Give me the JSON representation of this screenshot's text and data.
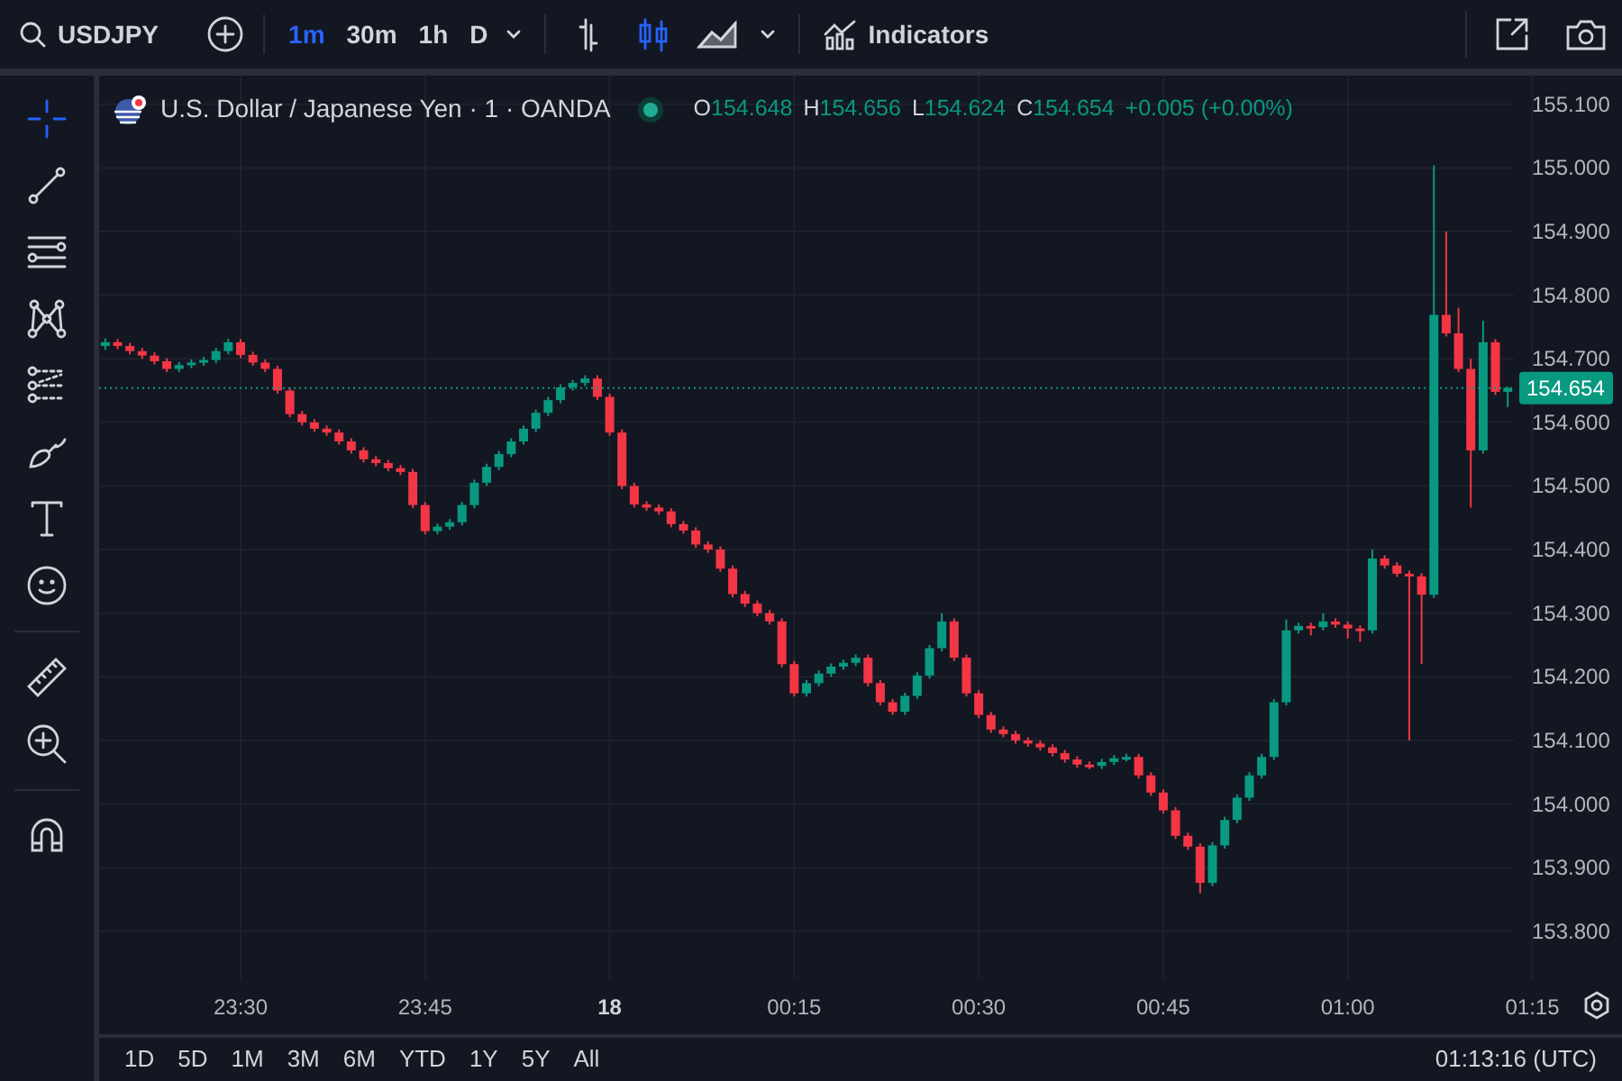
{
  "toolbar": {
    "symbol": "USDJPY",
    "timeframes": [
      {
        "label": "1m",
        "selected": true
      },
      {
        "label": "30m",
        "selected": false
      },
      {
        "label": "1h",
        "selected": false
      },
      {
        "label": "D",
        "selected": false
      }
    ],
    "chart_types": [
      {
        "kind": "bars",
        "selected": false
      },
      {
        "kind": "candles",
        "selected": true
      },
      {
        "kind": "area",
        "selected": false
      }
    ],
    "indicators_label": "Indicators"
  },
  "legend": {
    "title": "U.S. Dollar / Japanese Yen · 1 · OANDA",
    "ohlc": [
      {
        "label": "O",
        "value": "154.648"
      },
      {
        "label": "H",
        "value": "154.656"
      },
      {
        "label": "L",
        "value": "154.624"
      },
      {
        "label": "C",
        "value": "154.654"
      }
    ],
    "change": "+0.005 (+0.00%)"
  },
  "chart": {
    "chart_data": {
      "type": "candlestick",
      "grid": true,
      "ylim": [
        153.726,
        155.145
      ],
      "ref_lines": [
        {
          "axis": "y",
          "value": 154.654,
          "label": "154.654"
        }
      ],
      "yticks": [
        {
          "value": 155.1,
          "label": "155.100"
        },
        {
          "value": 155.0,
          "label": "155.000"
        },
        {
          "value": 154.9,
          "label": "154.900"
        },
        {
          "value": 154.8,
          "label": "154.800"
        },
        {
          "value": 154.7,
          "label": "154.700"
        },
        {
          "value": 154.6,
          "label": "154.600"
        },
        {
          "value": 154.5,
          "label": "154.500"
        },
        {
          "value": 154.4,
          "label": "154.400"
        },
        {
          "value": 154.3,
          "label": "154.300"
        },
        {
          "value": 154.2,
          "label": "154.200"
        },
        {
          "value": 154.1,
          "label": "154.100"
        },
        {
          "value": 154.0,
          "label": "154.000"
        },
        {
          "value": 153.9,
          "label": "153.900"
        },
        {
          "value": 153.8,
          "label": "153.800"
        }
      ],
      "categories": [
        null,
        null,
        null,
        null,
        null,
        null,
        null,
        null,
        null,
        null,
        null,
        null,
        null,
        null,
        null,
        null,
        null,
        null,
        null,
        null,
        null,
        null,
        null,
        null,
        null,
        null,
        null,
        null,
        null,
        null,
        null,
        null,
        null,
        null,
        null,
        null,
        null,
        null,
        null,
        null,
        null,
        null,
        null,
        null,
        null,
        null,
        null,
        null,
        null,
        null,
        null,
        null,
        null,
        null,
        null,
        null,
        null,
        null,
        null,
        null,
        null,
        null,
        null,
        null,
        null,
        null,
        null,
        null,
        null,
        null,
        null,
        null,
        null,
        null,
        null,
        null,
        null,
        null,
        null,
        null,
        null,
        null,
        null,
        null,
        null,
        null,
        null,
        null,
        null,
        null,
        null,
        null,
        null,
        null,
        null,
        null,
        null,
        null,
        null,
        null,
        null,
        null,
        null,
        null,
        null,
        null,
        null,
        null,
        null,
        null,
        null,
        null,
        null,
        null,
        null
      ],
      "ohlc": [
        [
          154.72,
          154.732,
          154.714,
          154.726
        ],
        [
          154.726,
          154.731,
          154.715,
          154.72
        ],
        [
          154.72,
          154.725,
          154.707,
          154.712
        ],
        [
          154.712,
          154.717,
          154.7,
          154.705
        ],
        [
          154.705,
          154.71,
          154.691,
          154.696
        ],
        [
          154.696,
          154.701,
          154.679,
          154.684
        ],
        [
          154.684,
          154.695,
          154.679,
          154.69
        ],
        [
          154.69,
          154.699,
          154.685,
          154.694
        ],
        [
          154.694,
          154.703,
          154.689,
          154.698
        ],
        [
          154.698,
          154.717,
          154.693,
          154.712
        ],
        [
          154.712,
          154.731,
          154.707,
          154.726
        ],
        [
          154.726,
          154.731,
          154.701,
          154.706
        ],
        [
          154.706,
          154.711,
          154.689,
          154.694
        ],
        [
          154.694,
          154.699,
          154.679,
          154.684
        ],
        [
          154.684,
          154.689,
          154.645,
          154.65
        ],
        [
          154.65,
          154.655,
          154.608,
          154.613
        ],
        [
          154.613,
          154.618,
          154.595,
          154.6
        ],
        [
          154.6,
          154.605,
          154.585,
          154.59
        ],
        [
          154.59,
          154.595,
          154.579,
          154.584
        ],
        [
          154.584,
          154.589,
          154.565,
          154.57
        ],
        [
          154.57,
          154.575,
          154.551,
          154.556
        ],
        [
          154.556,
          154.561,
          154.537,
          154.542
        ],
        [
          154.542,
          154.547,
          154.531,
          154.536
        ],
        [
          154.536,
          154.541,
          154.523,
          154.528
        ],
        [
          154.528,
          154.533,
          154.517,
          154.522
        ],
        [
          154.522,
          154.527,
          154.465,
          154.47
        ],
        [
          154.47,
          154.475,
          154.424,
          154.429
        ],
        [
          154.429,
          154.441,
          154.424,
          154.436
        ],
        [
          154.436,
          154.448,
          154.431,
          154.443
        ],
        [
          154.443,
          154.475,
          154.438,
          154.47
        ],
        [
          154.47,
          154.51,
          154.465,
          154.505
        ],
        [
          154.505,
          154.535,
          154.5,
          154.53
        ],
        [
          154.53,
          154.555,
          154.525,
          154.55
        ],
        [
          154.55,
          154.575,
          154.545,
          154.57
        ],
        [
          154.57,
          154.595,
          154.565,
          154.59
        ],
        [
          154.59,
          154.62,
          154.585,
          154.615
        ],
        [
          154.615,
          154.64,
          154.61,
          154.635
        ],
        [
          154.635,
          154.66,
          154.63,
          154.655
        ],
        [
          154.655,
          154.667,
          154.65,
          154.662
        ],
        [
          154.662,
          154.674,
          154.657,
          154.669
        ],
        [
          154.669,
          154.674,
          154.635,
          154.64
        ],
        [
          154.64,
          154.645,
          154.579,
          154.584
        ],
        [
          154.584,
          154.589,
          154.495,
          154.5
        ],
        [
          154.5,
          154.505,
          154.466,
          154.471
        ],
        [
          154.471,
          154.476,
          154.461,
          154.466
        ],
        [
          154.466,
          154.471,
          154.455,
          154.46
        ],
        [
          154.46,
          154.465,
          154.435,
          154.44
        ],
        [
          154.44,
          154.445,
          154.425,
          154.43
        ],
        [
          154.43,
          154.435,
          154.403,
          154.408
        ],
        [
          154.408,
          154.413,
          154.395,
          154.4
        ],
        [
          154.4,
          154.405,
          154.365,
          154.37
        ],
        [
          154.37,
          154.375,
          154.325,
          154.33
        ],
        [
          154.33,
          154.335,
          154.31,
          154.315
        ],
        [
          154.315,
          154.32,
          154.295,
          154.3
        ],
        [
          154.3,
          154.305,
          154.282,
          154.287
        ],
        [
          154.287,
          154.292,
          154.215,
          154.22
        ],
        [
          154.22,
          154.225,
          154.169,
          154.174
        ],
        [
          154.174,
          154.195,
          154.169,
          154.19
        ],
        [
          154.19,
          154.21,
          154.185,
          154.205
        ],
        [
          154.205,
          154.221,
          154.2,
          154.216
        ],
        [
          154.216,
          154.227,
          154.211,
          154.222
        ],
        [
          154.222,
          154.235,
          154.217,
          154.23
        ],
        [
          154.23,
          154.235,
          154.185,
          154.19
        ],
        [
          154.19,
          154.195,
          154.155,
          154.16
        ],
        [
          154.16,
          154.165,
          154.14,
          154.145
        ],
        [
          154.145,
          154.175,
          154.14,
          154.17
        ],
        [
          154.17,
          154.207,
          154.165,
          154.202
        ],
        [
          154.202,
          154.25,
          154.197,
          154.245
        ],
        [
          154.245,
          154.3,
          154.24,
          154.287
        ],
        [
          154.287,
          154.292,
          154.225,
          154.23
        ],
        [
          154.23,
          154.235,
          154.169,
          154.174
        ],
        [
          154.174,
          154.179,
          154.135,
          154.14
        ],
        [
          154.14,
          154.145,
          154.112,
          154.117
        ],
        [
          154.117,
          154.122,
          154.105,
          154.11
        ],
        [
          154.11,
          154.115,
          154.095,
          154.1
        ],
        [
          154.1,
          154.105,
          154.09,
          154.095
        ],
        [
          154.095,
          154.1,
          154.084,
          154.089
        ],
        [
          154.089,
          154.094,
          154.075,
          154.08
        ],
        [
          154.08,
          154.085,
          154.065,
          154.07
        ],
        [
          154.07,
          154.075,
          154.057,
          154.062
        ],
        [
          154.062,
          154.067,
          154.055,
          154.06
        ],
        [
          154.06,
          154.071,
          154.055,
          154.066
        ],
        [
          154.066,
          154.077,
          154.061,
          154.072
        ],
        [
          154.072,
          154.079,
          154.067,
          154.074
        ],
        [
          154.074,
          154.079,
          154.04,
          154.045
        ],
        [
          154.045,
          154.05,
          154.013,
          154.018
        ],
        [
          154.018,
          154.023,
          153.985,
          153.99
        ],
        [
          153.99,
          153.995,
          153.945,
          153.95
        ],
        [
          153.95,
          153.955,
          153.928,
          153.933
        ],
        [
          153.933,
          153.938,
          153.86,
          153.876
        ],
        [
          153.876,
          153.94,
          153.871,
          153.935
        ],
        [
          153.935,
          153.98,
          153.93,
          153.975
        ],
        [
          153.975,
          154.015,
          153.97,
          154.01
        ],
        [
          154.01,
          154.05,
          154.005,
          154.045
        ],
        [
          154.045,
          154.079,
          154.04,
          154.074
        ],
        [
          154.074,
          154.165,
          154.069,
          154.16
        ],
        [
          154.16,
          154.29,
          154.155,
          154.273
        ],
        [
          154.273,
          154.285,
          154.268,
          154.28
        ],
        [
          154.28,
          154.285,
          154.265,
          154.278
        ],
        [
          154.278,
          154.3,
          154.273,
          154.287
        ],
        [
          154.287,
          154.292,
          154.277,
          154.282
        ],
        [
          154.282,
          154.287,
          154.26,
          154.276
        ],
        [
          154.276,
          154.281,
          154.255,
          154.273
        ],
        [
          154.273,
          154.4,
          154.268,
          154.386
        ],
        [
          154.386,
          154.391,
          154.37,
          154.375
        ],
        [
          154.375,
          154.38,
          154.357,
          154.362
        ],
        [
          154.362,
          154.367,
          154.1,
          154.358
        ],
        [
          154.358,
          154.363,
          154.22,
          154.329
        ],
        [
          154.329,
          155.004,
          154.324,
          154.769
        ],
        [
          154.769,
          154.9,
          154.735,
          154.74
        ],
        [
          154.74,
          154.78,
          154.679,
          154.684
        ],
        [
          154.684,
          154.7,
          154.466,
          154.556
        ],
        [
          154.556,
          154.76,
          154.551,
          154.726
        ],
        [
          154.726,
          154.731,
          154.643,
          154.648
        ],
        [
          154.648,
          154.656,
          154.624,
          154.654
        ]
      ]
    }
  },
  "time_axis": {
    "labels": [
      {
        "text": "23:30",
        "kind": "time"
      },
      {
        "text": "23:45",
        "kind": "time"
      },
      {
        "text": "18",
        "kind": "day"
      },
      {
        "text": "00:15",
        "kind": "time"
      },
      {
        "text": "00:30",
        "kind": "time"
      },
      {
        "text": "00:45",
        "kind": "time"
      },
      {
        "text": "01:00",
        "kind": "time"
      },
      {
        "text": "01:15",
        "kind": "time"
      }
    ]
  },
  "bottom_bar": {
    "ranges": [
      "1D",
      "5D",
      "1M",
      "3M",
      "6M",
      "YTD",
      "1Y",
      "5Y",
      "All"
    ],
    "clock": "01:13:16 (UTC)"
  }
}
